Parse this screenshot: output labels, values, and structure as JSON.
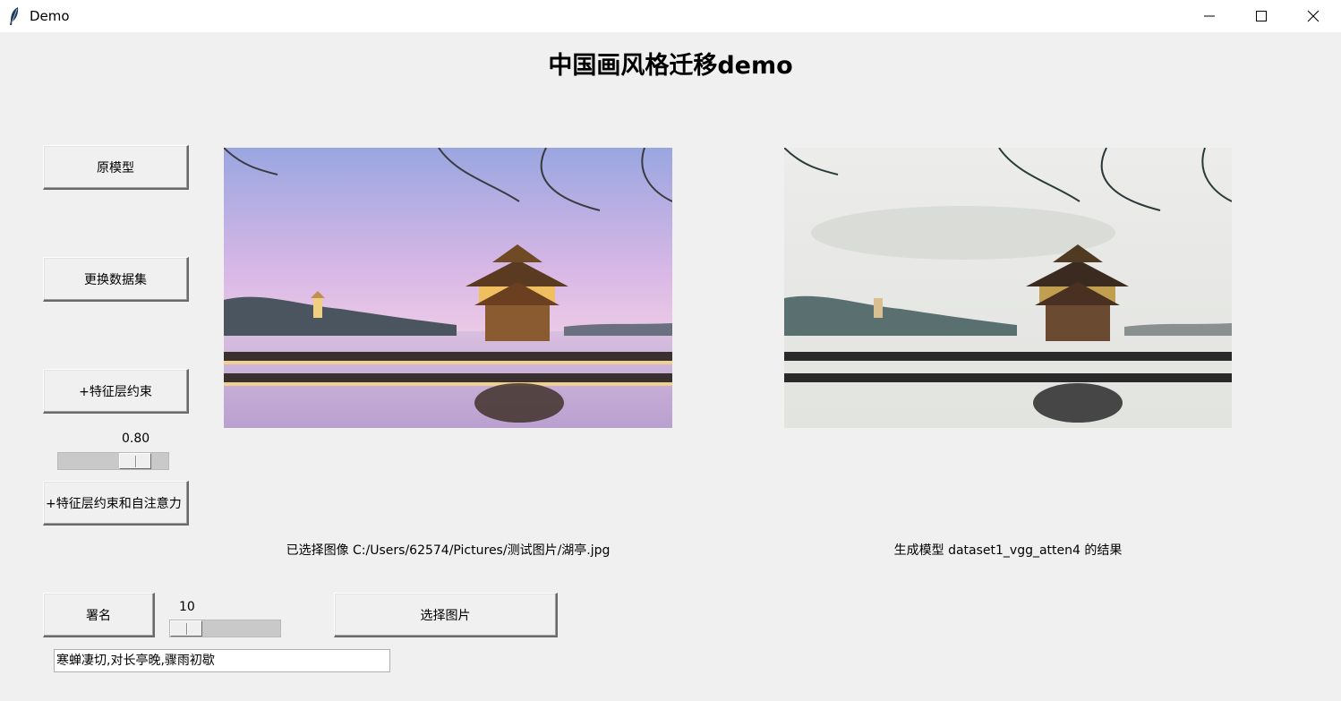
{
  "window": {
    "title": "Demo",
    "icons": {
      "app": "feather-icon",
      "minimize": "minimize-icon",
      "maximize": "maximize-icon",
      "close": "close-icon"
    }
  },
  "heading": "中国画风格迁移demo",
  "buttons": {
    "original_model": "原模型",
    "change_dataset": "更换数据集",
    "feature_constraint": "+特征层约束",
    "feature_attention": "+特征层约束和自注意力",
    "signature": "署名",
    "choose_image": "选择图片"
  },
  "sliders": {
    "feature_weight": {
      "value_label": "0.80",
      "value": 0.8
    },
    "signature_size": {
      "value_label": "10",
      "value": 10
    }
  },
  "images": {
    "input_alt": "湖亭",
    "output_alt": "湖亭 中国画风格"
  },
  "captions": {
    "input": "已选择图像 C:/Users/62574/Pictures/测试图片/湖亭.jpg",
    "output": "生成模型 dataset1_vgg_atten4 的结果"
  },
  "signature_text": "寒蝉凄切,对长亭晚,骤雨初歇",
  "colors": {
    "background": "#f0f0f0",
    "titlebar": "#ffffff"
  }
}
